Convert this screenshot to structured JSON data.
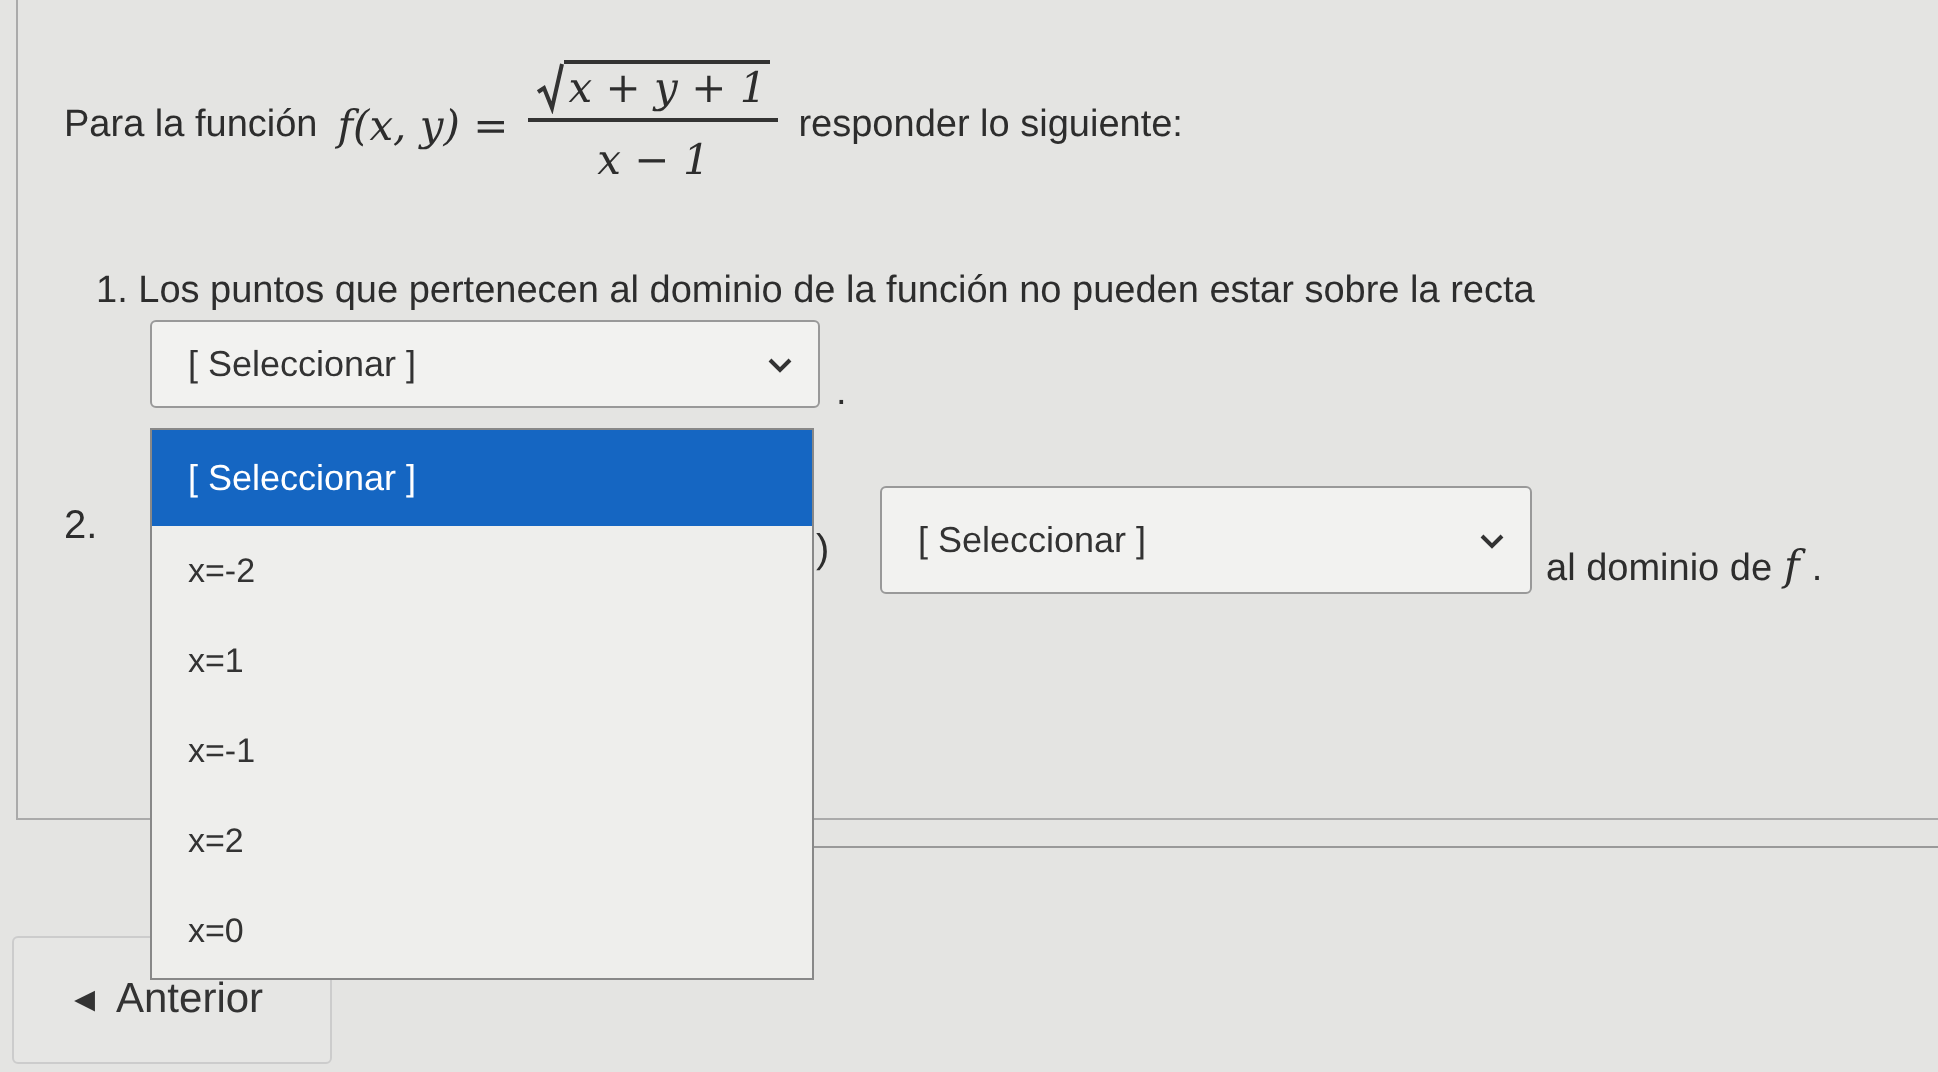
{
  "intro": {
    "before": "Para la función",
    "func": "f(x, y) =",
    "numerator": "x + y + 1",
    "denominator": "x − 1",
    "after": "responder lo siguiente:"
  },
  "questions": [
    {
      "number": "1.",
      "text": "Los puntos que pertenecen al dominio de la función no pueden estar sobre la recta",
      "select": "[ Seleccionar ]",
      "end": "."
    },
    {
      "number": "2.",
      "text": ")",
      "select": "[ Seleccionar ]",
      "tail": "al dominio de",
      "var": "f",
      "end": "."
    }
  ],
  "dropdown": {
    "options": [
      {
        "label": "[ Seleccionar ]",
        "selected": true
      },
      {
        "label": "x=-2",
        "selected": false
      },
      {
        "label": "x=1",
        "selected": false
      },
      {
        "label": "x=-1",
        "selected": false
      },
      {
        "label": "x=2",
        "selected": false
      },
      {
        "label": "x=0",
        "selected": false
      }
    ]
  },
  "nav": {
    "arrow": "◂",
    "label": "Anterior"
  }
}
